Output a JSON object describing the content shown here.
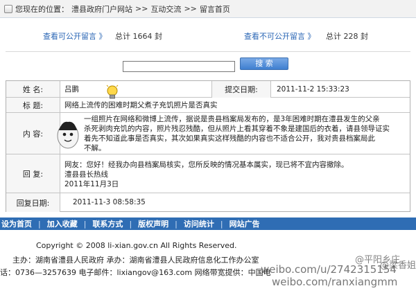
{
  "breadcrumb": {
    "prefix": "您现在的位置：",
    "items": [
      "澧县政府门户网站",
      ">>",
      "互动交流",
      ">>",
      "留言首页"
    ]
  },
  "stats": {
    "public_link": "查看可公开留言 》",
    "public_total": "总计 1664 封",
    "private_link": "查看不可公开留言 》",
    "private_total": "总计 228 封"
  },
  "search": {
    "placeholder": "",
    "button_label": "搜 索"
  },
  "message": {
    "name_label": "姓 名:",
    "name_value": "吕鹏",
    "date_label": "提交日期:",
    "date_value": "2011-11-2 15:33:23",
    "title_label": "标 题:",
    "title_value": "网络上流传的困难时期父煮子充饥照片是否真实",
    "content_label": "内 容:",
    "content_lines": [
      "一组照片在网络和微博上流传，据说是贵县档案局发布的，是3年困难时期在澧县发生的父亲",
      "杀死剥肉充饥的内容，照片残忍残酷，但从照片上看其穿着不象是建国后的衣着，请县领导证实",
      "着先不知道此事是否真实，其次如果真实这样残酷的内容也不适合公开，我对贵县档案局此",
      "不解。"
    ],
    "reply_label": "回 复:",
    "reply_lines": [
      "网友：您好！经我办向县档案局核实，您所反映的情况基本属实，现已将不宜内容撤除。",
      "澧县县长热线",
      "2011年11月3日"
    ],
    "reply_date_label": "回复日期:",
    "reply_date_value": "2011-11-3 08:58:35"
  },
  "footer": {
    "nav": [
      "设为首页",
      "加入收藏",
      "联系方式",
      "版权声明",
      "访问统计",
      "网站广告"
    ],
    "copyright": "Copyright © 2008 li-xian.gov.cn All Rights Reserved.",
    "host": "主办：湖南省澧县人民政府  承办：湖南省澧县人民政府信息化工作办公室",
    "contact": "话：0736—3257639  电子邮件：lixiangov@163.com  网络带宽提供：中国电"
  },
  "watermark": {
    "line1": "@平阳乡庄",
    "line2": "@梁香姐姐",
    "line3": "weibo.com/u/2742315154",
    "line4": "weibo.com/ranxiangmm"
  },
  "icons": [
    "home-icon",
    "lightbulb-icon",
    "egg-cartoon-icon"
  ]
}
